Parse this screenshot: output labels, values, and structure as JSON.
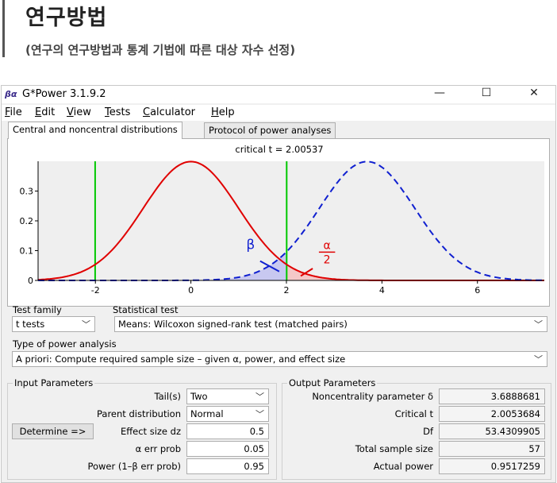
{
  "header": {
    "title": "연구방법",
    "subtitle": "(연구의 연구방법과 통계 기법에 따른 대상 자수 선정)"
  },
  "window": {
    "title": "G*Power 3.1.9.2",
    "icon_text": "βα",
    "minimize": "—",
    "maximize": "☐",
    "close": "✕"
  },
  "menu": [
    "File",
    "Edit",
    "View",
    "Tests",
    "Calculator",
    "Help"
  ],
  "tabs": [
    "Central and noncentral distributions",
    "Protocol of power analyses"
  ],
  "plot": {
    "critical_label": "critical t =  2.00537",
    "beta_label": "β",
    "alpha_label": "α",
    "alpha_den": "2",
    "y_ticks": [
      "0.3",
      "0.2",
      "0.1",
      "0"
    ],
    "x_ticks": [
      "-2",
      "0",
      "2",
      "4",
      "6"
    ],
    "colors": {
      "central": "#e00000",
      "noncentral": "#1020d0",
      "critical": "#00c800"
    }
  },
  "chart_data": {
    "type": "line",
    "series": [
      {
        "curve": "central t distribution",
        "mean": 0,
        "df": 53.4309905
      },
      {
        "curve": "noncentral t distribution",
        "noncentrality": 3.6888681,
        "df": 53.4309905
      }
    ],
    "critical_t": 2.00537,
    "xlim": [
      -3.2,
      7.4
    ],
    "ylim": [
      0,
      0.4
    ]
  },
  "test_family": {
    "label": "Test family",
    "value": "t tests"
  },
  "statistical_test": {
    "label": "Statistical test",
    "value": "Means: Wilcoxon signed-rank test (matched pairs)"
  },
  "power_analysis": {
    "label": "Type of power analysis",
    "value": "A priori: Compute required sample size – given α, power, and effect size"
  },
  "input": {
    "legend": "Input Parameters",
    "tails_label": "Tail(s)",
    "tails_value": "Two",
    "parent_label": "Parent distribution",
    "parent_value": "Normal",
    "determine": "Determine =>",
    "effect_label": "Effect size dz",
    "effect_value": "0.5",
    "alpha_label": "α err prob",
    "alpha_value": "0.05",
    "power_label": "Power (1–β err prob)",
    "power_value": "0.95"
  },
  "output": {
    "legend": "Output Parameters",
    "ncp_label": "Noncentrality parameter δ",
    "ncp_value": "3.6888681",
    "crit_label": "Critical t",
    "crit_value": "2.0053684",
    "df_label": "Df",
    "df_value": "53.4309905",
    "n_label": "Total sample size",
    "n_value": "57",
    "power_label": "Actual power",
    "power_value": "0.9517259"
  }
}
